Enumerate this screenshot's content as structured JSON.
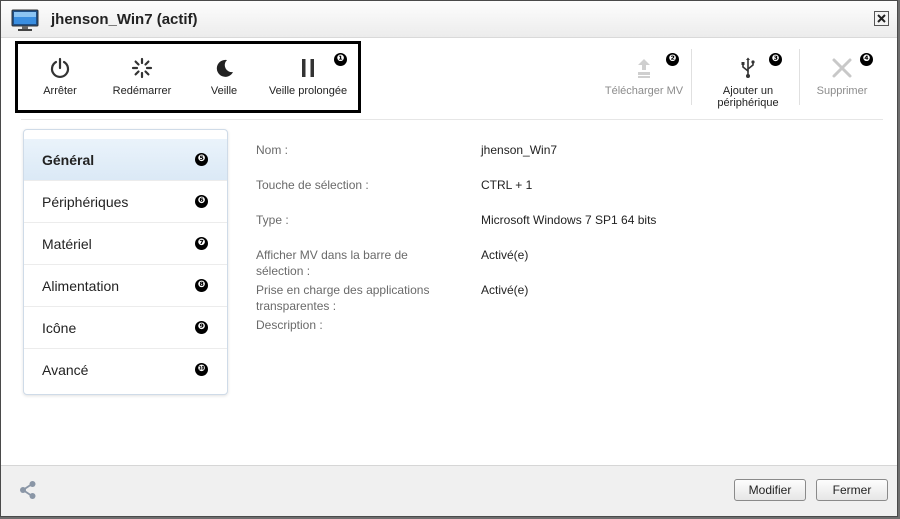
{
  "window": {
    "title": "jhenson_Win7 (actif)"
  },
  "toolbar": {
    "power": [
      {
        "label": "Arrêter",
        "icon": "power-icon"
      },
      {
        "label": "Redémarrer",
        "icon": "restart-spinner-icon"
      },
      {
        "label": "Veille",
        "icon": "moon-icon"
      },
      {
        "label": "Veille prolongée",
        "icon": "pause-icon"
      }
    ],
    "upload": {
      "label": "Télécharger MV",
      "icon": "upload-icon"
    },
    "add_device": {
      "label_line1": "Ajouter un",
      "label_line2": "périphérique",
      "icon": "usb-icon"
    },
    "delete": {
      "label": "Supprimer",
      "icon": "x-icon"
    },
    "markers": [
      "❶",
      "❷",
      "❸",
      "❹"
    ]
  },
  "sidebar": {
    "items": [
      {
        "label": "Général",
        "marker": "❺",
        "active": true
      },
      {
        "label": "Périphériques",
        "marker": "❻"
      },
      {
        "label": "Matériel",
        "marker": "❼"
      },
      {
        "label": "Alimentation",
        "marker": "❽"
      },
      {
        "label": "Icône",
        "marker": "❾"
      },
      {
        "label": "Avancé",
        "marker": "❿"
      }
    ]
  },
  "details": [
    {
      "label_line1": "Nom :",
      "label_line2": "",
      "value": "jhenson_Win7"
    },
    {
      "label_line1": "Touche de sélection :",
      "label_line2": "",
      "value": "CTRL + 1"
    },
    {
      "label_line1": "Type :",
      "label_line2": "",
      "value": "Microsoft Windows 7 SP1 64 bits"
    },
    {
      "label_line1": "Afficher MV dans la barre de",
      "label_line2": "sélection :",
      "value": "Activé(e)"
    },
    {
      "label_line1": "Prise en charge des applications",
      "label_line2": "transparentes :",
      "value": "Activé(e)"
    },
    {
      "label_line1": "Description :",
      "label_line2": "",
      "value": ""
    }
  ],
  "footer": {
    "modify_label": "Modifier",
    "close_label": "Fermer"
  },
  "colors": {
    "active_item_bg": "#dbe9f6",
    "disabled_text": "#8c8c8c"
  }
}
